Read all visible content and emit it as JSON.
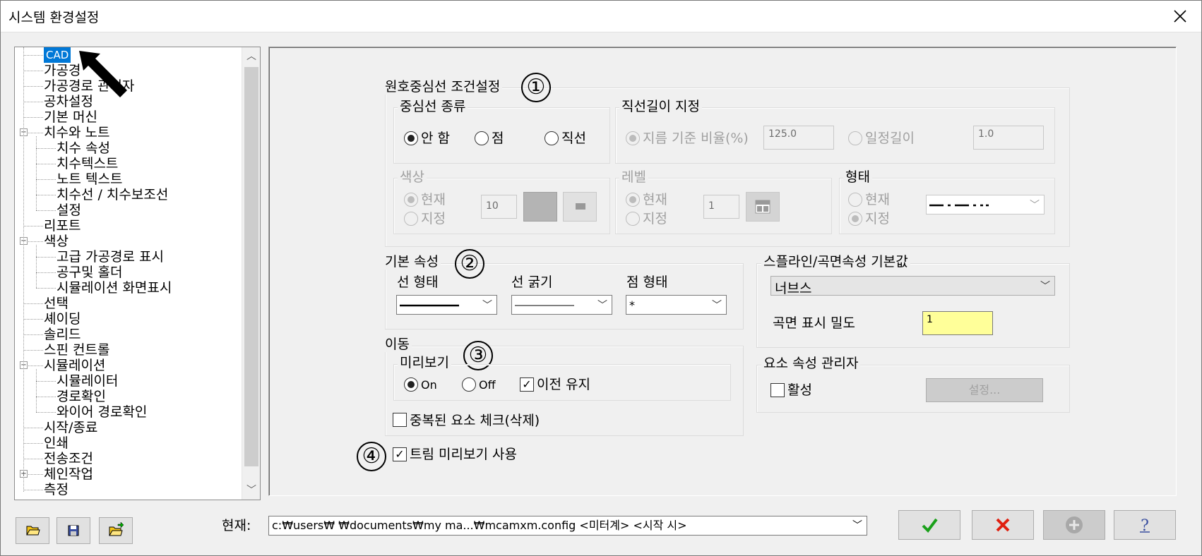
{
  "window": {
    "title": "시스템 환경설정"
  },
  "tree": {
    "items": [
      {
        "label": "CAD",
        "selected": true
      },
      {
        "label": "가공경"
      },
      {
        "label": "가공경로 관리자"
      },
      {
        "label": "공차설정"
      },
      {
        "label": "기본 머신"
      },
      {
        "label": "치수와 노트",
        "expander": "⊟"
      },
      {
        "label": "치수 속성"
      },
      {
        "label": "치수텍스트"
      },
      {
        "label": "노트 텍스트"
      },
      {
        "label": "치수선 / 치수보조선"
      },
      {
        "label": "설정"
      },
      {
        "label": "리포트"
      },
      {
        "label": "색상",
        "expander": "⊟"
      },
      {
        "label": "고급 가공경로 표시"
      },
      {
        "label": "공구및 홀더"
      },
      {
        "label": "시뮬레이션 화면표시"
      },
      {
        "label": "선택"
      },
      {
        "label": "셰이딩"
      },
      {
        "label": "솔리드"
      },
      {
        "label": "스핀 컨트롤"
      },
      {
        "label": "시뮬레이션",
        "expander": "⊟"
      },
      {
        "label": "시뮬레이터"
      },
      {
        "label": "경로확인"
      },
      {
        "label": "와이어 경로확인"
      },
      {
        "label": "시작/종료"
      },
      {
        "label": "인쇄"
      },
      {
        "label": "전송조건"
      },
      {
        "label": "체인작업",
        "expander": "⊞"
      },
      {
        "label": "측정"
      }
    ]
  },
  "annotations": {
    "n1": "①",
    "n2": "②",
    "n3": "③",
    "n4": "④"
  },
  "centerline": {
    "title": "원호중심선 조건설정",
    "type": {
      "title": "중심선 종류",
      "opt_none": "안 함",
      "opt_point": "점",
      "opt_line": "직선"
    },
    "length": {
      "title": "직선길이 지정",
      "opt_ratio": "지름 기준 비율(%)",
      "ratio_value": "125.0",
      "opt_fixed": "일정길이",
      "fixed_value": "1.0"
    },
    "color": {
      "title": "색상",
      "opt_current": "현재",
      "opt_specify": "지정",
      "value": "10"
    },
    "level": {
      "title": "레벨",
      "opt_current": "현재",
      "opt_specify": "지정",
      "value": "1"
    },
    "style": {
      "title": "형태",
      "opt_current": "현재",
      "opt_specify": "지정"
    }
  },
  "basic": {
    "title": "기본 속성",
    "line_style_label": "선 형태",
    "line_width_label": "선 굵기",
    "point_style_label": "점 형태",
    "point_style_value": "*"
  },
  "spline": {
    "title": "스플라인/곡면속성 기본값",
    "type_value": "너브스",
    "density_label": "곡면 표시 밀도",
    "density_value": "1"
  },
  "move": {
    "title": "이동",
    "preview_title": "미리보기",
    "opt_on": "On",
    "opt_off": "Off",
    "keep_prev": "이전 유지",
    "dup_check": "중복된 요소 체크(삭제)"
  },
  "attr_manager": {
    "title": "요소 속성 관리자",
    "active": "활성",
    "settings_btn": "설정..."
  },
  "trim_preview": "트림 미리보기 사용",
  "footer": {
    "current_label": "현재:",
    "path": "c:₩users₩              ₩documents₩my ma...₩mcamxm.config <미터계> <시작 시>"
  },
  "colors": {
    "selection": "#0078d7",
    "density_bg": "#ffff99",
    "ok": "#1aa01a",
    "cancel": "#e02010"
  }
}
